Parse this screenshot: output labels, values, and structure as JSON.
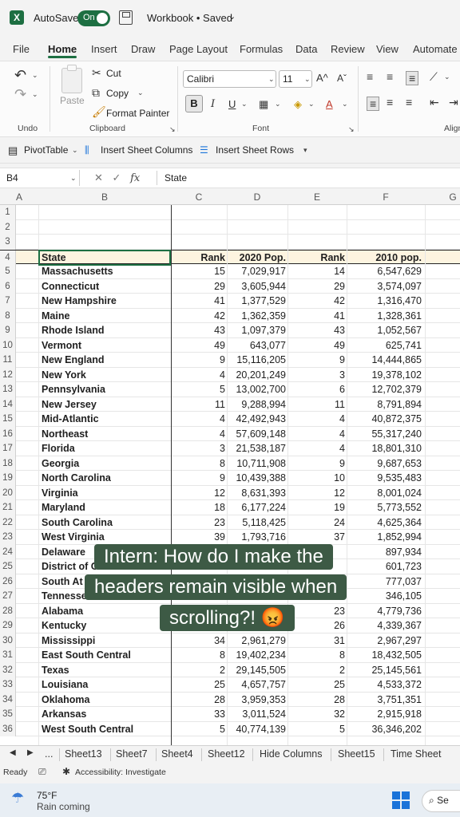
{
  "titlebar": {
    "autosave_label": "AutoSave",
    "autosave_state": "On",
    "workbook_title": "Workbook • Saved",
    "chevron": "⌄"
  },
  "tabs": [
    "File",
    "Home",
    "Insert",
    "Draw",
    "Page Layout",
    "Formulas",
    "Data",
    "Review",
    "View",
    "Automate"
  ],
  "active_tab": "Home",
  "ribbon": {
    "undo_label": "Undo",
    "paste_label": "Paste",
    "cut_label": "Cut",
    "copy_label": "Copy",
    "format_painter_label": "Format Painter",
    "clipboard_label": "Clipboard",
    "font_name": "Calibri",
    "font_size": "11",
    "font_label": "Font",
    "align_label": "Align"
  },
  "quickbar": {
    "pivot_label": "PivotTable",
    "insert_cols_label": "Insert Sheet Columns",
    "insert_rows_label": "Insert Sheet Rows"
  },
  "formula_bar": {
    "cell_ref": "B4",
    "value": "State"
  },
  "columns": [
    "A",
    "B",
    "C",
    "D",
    "E",
    "F",
    "G"
  ],
  "empty_rows": [
    "1",
    "2",
    "3"
  ],
  "table_header": {
    "row": "4",
    "state": "State",
    "rank": "Rank",
    "pop2020": "2020 Pop.",
    "rank2": "Rank",
    "pop2010": "2010 pop."
  },
  "rows": [
    {
      "row": "5",
      "state": "Massachusetts",
      "rank": "15",
      "pop2020": "7,029,917",
      "rank2": "14",
      "pop2010": "6,547,629"
    },
    {
      "row": "6",
      "state": "Connecticut",
      "rank": "29",
      "pop2020": "3,605,944",
      "rank2": "29",
      "pop2010": "3,574,097"
    },
    {
      "row": "7",
      "state": "New Hampshire",
      "rank": "41",
      "pop2020": "1,377,529",
      "rank2": "42",
      "pop2010": "1,316,470"
    },
    {
      "row": "8",
      "state": "Maine",
      "rank": "42",
      "pop2020": "1,362,359",
      "rank2": "41",
      "pop2010": "1,328,361"
    },
    {
      "row": "9",
      "state": "Rhode Island",
      "rank": "43",
      "pop2020": "1,097,379",
      "rank2": "43",
      "pop2010": "1,052,567"
    },
    {
      "row": "10",
      "state": "Vermont",
      "rank": "49",
      "pop2020": "643,077",
      "rank2": "49",
      "pop2010": "625,741"
    },
    {
      "row": "11",
      "state": "New England",
      "rank": "9",
      "pop2020": "15,116,205",
      "rank2": "9",
      "pop2010": "14,444,865"
    },
    {
      "row": "12",
      "state": "New York",
      "rank": "4",
      "pop2020": "20,201,249",
      "rank2": "3",
      "pop2010": "19,378,102"
    },
    {
      "row": "13",
      "state": "Pennsylvania",
      "rank": "5",
      "pop2020": "13,002,700",
      "rank2": "6",
      "pop2010": "12,702,379"
    },
    {
      "row": "14",
      "state": "New Jersey",
      "rank": "11",
      "pop2020": "9,288,994",
      "rank2": "11",
      "pop2010": "8,791,894"
    },
    {
      "row": "15",
      "state": "Mid-Atlantic",
      "rank": "4",
      "pop2020": "42,492,943",
      "rank2": "4",
      "pop2010": "40,872,375"
    },
    {
      "row": "16",
      "state": "Northeast",
      "rank": "4",
      "pop2020": "57,609,148",
      "rank2": "4",
      "pop2010": "55,317,240"
    },
    {
      "row": "17",
      "state": "Florida",
      "rank": "3",
      "pop2020": "21,538,187",
      "rank2": "4",
      "pop2010": "18,801,310"
    },
    {
      "row": "18",
      "state": "Georgia",
      "rank": "8",
      "pop2020": "10,711,908",
      "rank2": "9",
      "pop2010": "9,687,653"
    },
    {
      "row": "19",
      "state": "North Carolina",
      "rank": "9",
      "pop2020": "10,439,388",
      "rank2": "10",
      "pop2010": "9,535,483"
    },
    {
      "row": "20",
      "state": "Virginia",
      "rank": "12",
      "pop2020": "8,631,393",
      "rank2": "12",
      "pop2010": "8,001,024"
    },
    {
      "row": "21",
      "state": "Maryland",
      "rank": "18",
      "pop2020": "6,177,224",
      "rank2": "19",
      "pop2010": "5,773,552"
    },
    {
      "row": "22",
      "state": "South Carolina",
      "rank": "23",
      "pop2020": "5,118,425",
      "rank2": "24",
      "pop2010": "4,625,364"
    },
    {
      "row": "23",
      "state": "West Virginia",
      "rank": "39",
      "pop2020": "1,793,716",
      "rank2": "37",
      "pop2010": "1,852,994"
    },
    {
      "row": "24",
      "state": "Delaware",
      "rank": "",
      "pop2020": "",
      "rank2": "",
      "pop2010": "897,934"
    },
    {
      "row": "25",
      "state": "District of C",
      "rank": "",
      "pop2020": "",
      "rank2": "",
      "pop2010": "601,723"
    },
    {
      "row": "26",
      "state": "South At",
      "rank": "",
      "pop2020": "",
      "rank2": "",
      "pop2010": "777,037"
    },
    {
      "row": "27",
      "state": "Tennesse",
      "rank": "",
      "pop2020": "",
      "rank2": "",
      "pop2010": "346,105"
    },
    {
      "row": "28",
      "state": "Alabama",
      "rank": "",
      "pop2020": "",
      "rank2": "23",
      "pop2010": "4,779,736"
    },
    {
      "row": "29",
      "state": "Kentucky",
      "rank": "",
      "pop2020": "",
      "rank2": "26",
      "pop2010": "4,339,367"
    },
    {
      "row": "30",
      "state": "Mississippi",
      "rank": "34",
      "pop2020": "2,961,279",
      "rank2": "31",
      "pop2010": "2,967,297"
    },
    {
      "row": "31",
      "state": "East South Central",
      "rank": "8",
      "pop2020": "19,402,234",
      "rank2": "8",
      "pop2010": "18,432,505"
    },
    {
      "row": "32",
      "state": "Texas",
      "rank": "2",
      "pop2020": "29,145,505",
      "rank2": "2",
      "pop2010": "25,145,561"
    },
    {
      "row": "33",
      "state": "Louisiana",
      "rank": "25",
      "pop2020": "4,657,757",
      "rank2": "25",
      "pop2010": "4,533,372"
    },
    {
      "row": "34",
      "state": "Oklahoma",
      "rank": "28",
      "pop2020": "3,959,353",
      "rank2": "28",
      "pop2010": "3,751,351"
    },
    {
      "row": "35",
      "state": "Arkansas",
      "rank": "33",
      "pop2020": "3,011,524",
      "rank2": "32",
      "pop2010": "2,915,918"
    },
    {
      "row": "36",
      "state": "West South Central",
      "rank": "5",
      "pop2020": "40,774,139",
      "rank2": "5",
      "pop2010": "36,346,202"
    }
  ],
  "caption": {
    "line1": "Intern: How do I make the",
    "line2": "headers remain visible when",
    "line3": "scrolling?! 😡"
  },
  "sheets": [
    "...",
    "Sheet13",
    "Sheet7",
    "Sheet4",
    "Sheet12",
    "Hide Columns",
    "Sheet15",
    "Time Sheet"
  ],
  "status": {
    "ready": "Ready",
    "accessibility": "Accessibility: Investigate"
  },
  "taskbar": {
    "temperature": "75°F",
    "weather": "Rain coming",
    "search_label": "Se"
  },
  "colors": {
    "accent": "#1d6f42",
    "caption_bg": "#3d5a45",
    "header_fill": "#fdf4e0"
  }
}
